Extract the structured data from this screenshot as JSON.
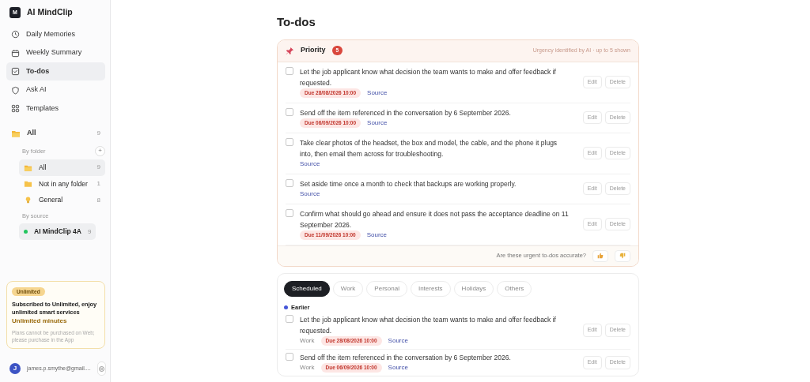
{
  "app": {
    "name": "AI MindClip",
    "logo": "M"
  },
  "nav": [
    {
      "label": "Daily Memories",
      "kind": "clock",
      "selected": false
    },
    {
      "label": "Weekly Summary",
      "kind": "calendar",
      "selected": false
    },
    {
      "label": "To-dos",
      "kind": "check",
      "selected": true
    },
    {
      "label": "Ask AI",
      "kind": "shield",
      "selected": false
    },
    {
      "label": "Templates",
      "kind": "grid",
      "selected": false
    }
  ],
  "all_folders": {
    "label": "All",
    "count": "9"
  },
  "by_folder": {
    "label": "By folder",
    "add": "+"
  },
  "folders": [
    {
      "label": "All",
      "count": "9",
      "kind": "folder-open",
      "selected": true
    },
    {
      "label": "Not in any folder",
      "count": "1",
      "kind": "folder",
      "selected": false
    },
    {
      "label": "General",
      "count": "8",
      "kind": "bulb",
      "selected": false
    }
  ],
  "by_source": {
    "label": "By source"
  },
  "sources": [
    {
      "label": "AI MindClip 4A",
      "count": "9",
      "color": "#22c55e",
      "selected": true
    }
  ],
  "plan": {
    "badge": "Unlimited",
    "title": "Subscribed to Unlimited, enjoy unlimited smart services",
    "subtitle": "Unlimited minutes",
    "note": "Plans cannot be purchased on Web; please purchase in the App"
  },
  "user": {
    "initial": "J",
    "email": "james.p.smythe@gmail...."
  },
  "page_title": "To-dos",
  "priority": {
    "title": "Priority",
    "count": "5",
    "note": "Urgency identified by AI · up to 5 shown",
    "items": [
      {
        "text": "Let the job applicant know what decision the team wants to make and offer feedback if requested.",
        "due": "Due 28/08/2026 10:00",
        "source": "Source",
        "checked": false,
        "edit": "Edit",
        "delete": "Delete"
      },
      {
        "text": "Send off the item referenced in the conversation by 6 September 2026.",
        "due": "Due 06/09/2026 10:00",
        "source": "Source",
        "checked": false,
        "edit": "Edit",
        "delete": "Delete"
      },
      {
        "text": "Take clear photos of the headset, the box and model, the cable, and the phone it plugs into, then email them across for troubleshooting.",
        "source": "Source",
        "checked": false,
        "edit": "Edit",
        "delete": "Delete"
      },
      {
        "text": "Set aside time once a month to check that backups are working properly.",
        "source": "Source",
        "checked": false,
        "edit": "Edit",
        "delete": "Delete"
      },
      {
        "text": "Confirm what should go ahead and ensure it does not pass the acceptance deadline on 11 September 2026.",
        "due": "Due 11/09/2026 10:00",
        "source": "Source",
        "checked": false,
        "edit": "Edit",
        "delete": "Delete"
      }
    ],
    "feedback": "Are these urgent to-dos accurate?"
  },
  "tabs": [
    {
      "label": "Scheduled",
      "selected": true
    },
    {
      "label": "Work",
      "selected": false
    },
    {
      "label": "Personal",
      "selected": false
    },
    {
      "label": "Interests",
      "selected": false
    },
    {
      "label": "Holidays",
      "selected": false
    },
    {
      "label": "Others",
      "selected": false
    }
  ],
  "group": {
    "label": "Earlier",
    "color": "#4656d8"
  },
  "items": [
    {
      "category": "Work",
      "text": "Let the job applicant know what decision the team wants to make and offer feedback if requested.",
      "due": "Due 28/08/2026 10:00",
      "source": "Source",
      "checked": false,
      "edit": "Edit",
      "delete": "Delete"
    },
    {
      "category": "Work",
      "text": "Send off the item referenced in the conversation by 6 September 2026.",
      "due": "Due 06/09/2026 10:00",
      "source": "Source",
      "checked": false,
      "edit": "Edit",
      "delete": "Delete"
    }
  ]
}
